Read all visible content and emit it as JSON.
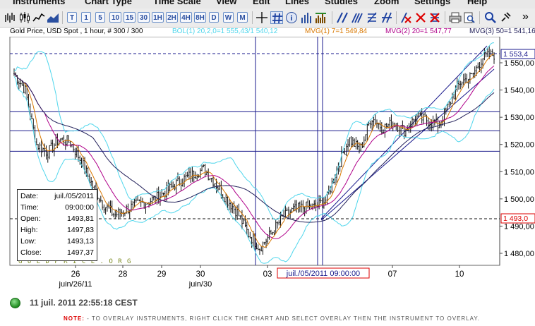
{
  "menu": {
    "items": [
      "Instruments",
      "Chart Type",
      "Time Scale",
      "View",
      "Edit",
      "Lines",
      "Studies",
      "Zoom",
      "Settings",
      "Help"
    ]
  },
  "toolbar": {
    "period_buttons": [
      "T",
      "1",
      "5",
      "10",
      "15",
      "30",
      "1H",
      "2H",
      "4H",
      "8H",
      "D",
      "W",
      "M"
    ],
    "more_label": "»"
  },
  "info": {
    "instrument": "Gold Price, USD Spot , 1 hour, # 300 / 300",
    "bol": "BOL(1) 20,2,0=1 555,43/1 540,12",
    "mvg1": "MVG(1) 7=1 549,84",
    "mvg2": "MVG(2) 20=1 547,77",
    "mvg3": "MVG(3) 50=1 541,16",
    "colors": {
      "bol": "#4fd6ec",
      "mvg1": "#d97800",
      "mvg2": "#b0008a",
      "mvg3": "#22205a"
    }
  },
  "chart_data": {
    "type": "candlestick",
    "x_ticks": [
      "26",
      "28",
      "29",
      "30",
      "03",
      "07",
      "10"
    ],
    "x_sublabels": [
      "juin/26/11",
      "juin/30"
    ],
    "y_ticks": [
      "1 550,00",
      "1 540,00",
      "1 530,00",
      "1 520,00",
      "1 510,00",
      "1 500,00",
      "1 490,00",
      "1 480,00"
    ],
    "ylim": [
      1475,
      1560
    ],
    "price_tags": {
      "last": "1 553,4",
      "cursor": "1 493,0"
    },
    "cursor_time_label": "juil./05/2011 09:00:00",
    "watermark": "G O L D P R I C E . O R G",
    "horizontal_lines": [
      1532,
      1525,
      1517.5
    ],
    "indicators": [
      "BOL(1) 20,2",
      "MVG(1) 7",
      "MVG(2) 20",
      "MVG(3) 50"
    ],
    "close_path": [
      1546,
      1540,
      1520,
      1517,
      1522,
      1521,
      1514,
      1505,
      1498,
      1494,
      1496,
      1498,
      1499,
      1501,
      1504,
      1507,
      1509,
      1511,
      1506,
      1500,
      1495,
      1487,
      1482,
      1487,
      1493,
      1496,
      1497,
      1497,
      1500,
      1512,
      1522,
      1518,
      1530,
      1526,
      1528,
      1525,
      1530,
      1529,
      1527,
      1535,
      1543,
      1545,
      1552,
      1553
    ]
  },
  "tooltip": {
    "rows": [
      {
        "k": "Date:",
        "v": "juil./05/2011"
      },
      {
        "k": "Time:",
        "v": "09:00:00"
      },
      {
        "k": "Open:",
        "v": "1493,81"
      },
      {
        "k": "High:",
        "v": "1497,83"
      },
      {
        "k": "Low:",
        "v": "1493,13"
      },
      {
        "k": "Close:",
        "v": "1497,37"
      }
    ]
  },
  "status": {
    "timestamp": "11 juil. 2011 22:55:18 CEST",
    "note_label": "NOTE:",
    "note_text": " - TO OVERLAY INSTRUMENTS, RIGHT CLICK THE CHART AND SELECT OVERLAY THEN THE INSTRUMENT TO OVERLAY."
  }
}
